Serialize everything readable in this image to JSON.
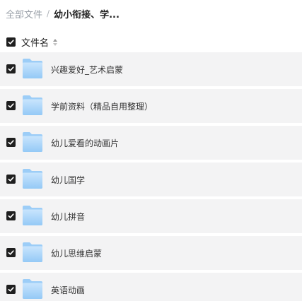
{
  "breadcrumb": {
    "root": "全部文件",
    "separator": "/",
    "current": "幼小衔接、学..."
  },
  "list_header": {
    "name_label": "文件名",
    "checked": true
  },
  "rows": [
    {
      "name": "兴趣爱好_艺术启蒙",
      "checked": true,
      "icon": "folder-icon"
    },
    {
      "name": "学前资料（精品自用整理）",
      "checked": true,
      "icon": "folder-icon"
    },
    {
      "name": "幼儿爱看的动画片",
      "checked": true,
      "icon": "folder-icon"
    },
    {
      "name": "幼儿国学",
      "checked": true,
      "icon": "folder-icon"
    },
    {
      "name": "幼儿拼音",
      "checked": true,
      "icon": "folder-icon"
    },
    {
      "name": "幼儿思维启蒙",
      "checked": true,
      "icon": "folder-icon"
    },
    {
      "name": "英语动画",
      "checked": true,
      "icon": "folder-icon"
    }
  ],
  "colors": {
    "row_background": "#f3f3f4",
    "checkbox_fill": "#1f1f1f",
    "folder_light": "#b9dcfb",
    "folder_dark": "#8ec5f5"
  }
}
